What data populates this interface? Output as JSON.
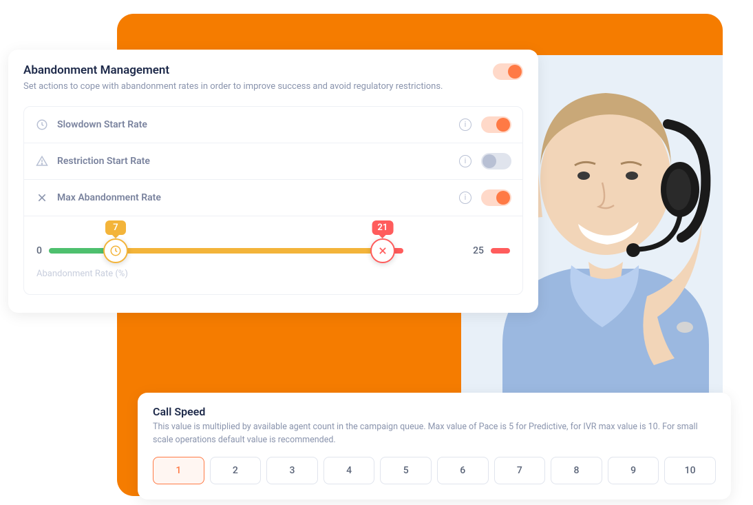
{
  "abandon": {
    "title": "Abandonment Management",
    "subtitle": "Set actions to cope with abandonment rates in order to improve success and avoid regulatory restrictions.",
    "master_on": true,
    "rows": [
      {
        "label": "Slowdown Start Rate",
        "on": true
      },
      {
        "label": "Restriction Start Rate",
        "on": false
      },
      {
        "label": "Max Abandonment Rate",
        "on": true
      }
    ],
    "slider": {
      "min": "0",
      "max": "25",
      "val1": "7",
      "val2": "21",
      "axis_label": "Abandonment Rate (%)"
    }
  },
  "speed": {
    "title": "Call Speed",
    "subtitle": "This value is multiplied by available agent count in the campaign queue. Max value of Pace is 5 for Predictive, for IVR max value is 10. For small scale operations default value is recommended.",
    "options": [
      "1",
      "2",
      "3",
      "4",
      "5",
      "6",
      "7",
      "8",
      "9",
      "10"
    ],
    "selected": "1"
  }
}
